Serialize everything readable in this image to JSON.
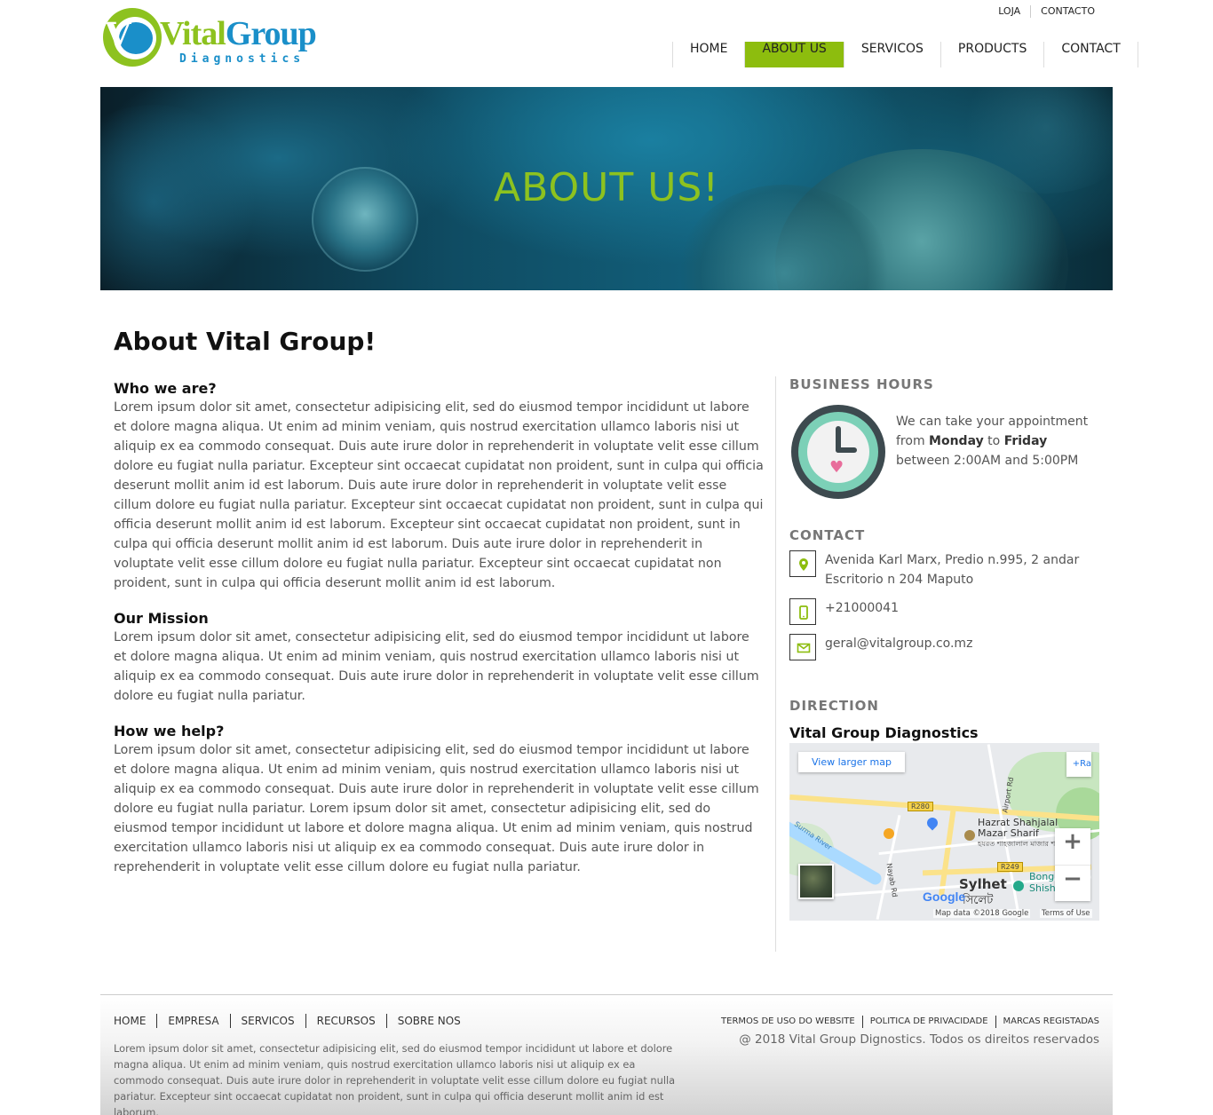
{
  "header": {
    "logo": {
      "brand_primary": "Vital",
      "brand_secondary": "Group",
      "tagline": "Diagnostics"
    },
    "top_links": [
      "LOJA",
      "CONTACTO"
    ],
    "nav": [
      {
        "label": "HOME",
        "active": false
      },
      {
        "label": "ABOUT US",
        "active": true
      },
      {
        "label": "SERVICOS",
        "active": false
      },
      {
        "label": "PRODUCTS",
        "active": false
      },
      {
        "label": "CONTACT",
        "active": false
      }
    ]
  },
  "hero": {
    "title": "ABOUT US!"
  },
  "main": {
    "page_title": "About Vital Group!",
    "sections": [
      {
        "heading": "Who we are?",
        "body": "Lorem ipsum dolor sit amet, consectetur adipisicing elit, sed do eiusmod tempor incididunt ut labore et dolore magna aliqua. Ut enim ad minim veniam, quis nostrud exercitation ullamco laboris nisi ut aliquip ex ea commodo consequat. Duis aute irure dolor in reprehenderit in voluptate velit esse cillum dolore eu fugiat nulla pariatur. Excepteur sint occaecat cupidatat non proident, sunt in culpa qui officia deserunt mollit anim id est laborum. Duis aute irure dolor in reprehenderit in voluptate velit esse cillum dolore eu fugiat nulla pariatur. Excepteur sint occaecat cupidatat non proident, sunt in culpa qui officia deserunt mollit anim id est laborum. Excepteur sint occaecat cupidatat non proident, sunt in culpa qui officia deserunt mollit anim id est laborum. Duis aute irure dolor in reprehenderit in voluptate velit esse cillum dolore eu fugiat nulla pariatur. Excepteur sint occaecat cupidatat non proident, sunt in culpa qui officia deserunt mollit anim id est laborum."
      },
      {
        "heading": "Our Mission",
        "body": "Lorem ipsum dolor sit amet, consectetur adipisicing elit, sed do eiusmod tempor incididunt ut labore et dolore magna aliqua. Ut enim ad minim veniam, quis nostrud exercitation ullamco laboris nisi ut aliquip ex ea commodo consequat. Duis aute irure dolor in reprehenderit in voluptate velit esse cillum dolore eu fugiat nulla pariatur."
      },
      {
        "heading": "How we help?",
        "body": "Lorem ipsum dolor sit amet, consectetur adipisicing elit, sed do eiusmod tempor incididunt ut labore et dolore magna aliqua. Ut enim ad minim veniam, quis nostrud exercitation ullamco laboris nisi ut aliquip ex ea commodo consequat. Duis aute irure dolor in reprehenderit in voluptate velit esse cillum dolore eu fugiat nulla pariatur. Lorem ipsum dolor sit amet, consectetur adipisicing elit, sed do eiusmod tempor incididunt ut labore et dolore magna aliqua. Ut enim ad minim veniam, quis nostrud exercitation ullamco laboris nisi ut aliquip ex ea commodo consequat. Duis aute irure dolor in reprehenderit in voluptate velit esse cillum dolore eu fugiat nulla pariatur."
      }
    ]
  },
  "sidebar": {
    "hours": {
      "heading": "BUSINESS HOURS",
      "text_before": "We can take your appointment from ",
      "day_from": "Monday",
      "text_mid": " to ",
      "day_to": "Friday",
      "text_after": " between 2:00AM and 5:00PM",
      "icon": "clock-icon"
    },
    "contact": {
      "heading": "CONTACT",
      "address": "Avenida Karl Marx, Predio n.995, 2 andar Escritorio n 204 Maputo",
      "phone": "+21000041",
      "email": "geral@vitalgroup.co.mz"
    },
    "direction": {
      "heading": "DIRECTION",
      "map_title": "Vital Group Diagnostics",
      "view_larger": "View larger map",
      "ra_link": "+Ra",
      "labels": {
        "road_r280": "R280",
        "road_r249": "R249",
        "shahjalal": "Hazrat Shahjalal Mazar Sharif",
        "shahjalal_bn": "হযরত শাহজালাল মাজার শরীফ",
        "sylhet": "Sylhet",
        "sylhet_bn": "সিলেট",
        "surma": "Surma River",
        "airport_rd": "Airport Rd",
        "nayab_rd": "Nayab Rd",
        "bongo": "Bong",
        "shish": "Shish",
        "google": "Google",
        "map_data": "Map data ©2018 Google",
        "terms": "Terms of Use"
      },
      "zoom_in": "+",
      "zoom_out": "−"
    }
  },
  "footer": {
    "nav": [
      "HOME",
      "EMPRESA",
      "SERVICOS",
      "RECURSOS",
      "SOBRE NOS"
    ],
    "text": "Lorem ipsum dolor sit amet, consectetur adipisicing elit, sed do eiusmod tempor incididunt ut labore et dolore magna aliqua. Ut enim ad minim veniam, quis nostrud exercitation ullamco laboris nisi ut aliquip ex ea commodo consequat. Duis aute irure dolor in reprehenderit in voluptate velit esse cillum dolore eu fugiat nulla pariatur. Excepteur sint occaecat cupidatat non proident, sunt in culpa qui officia deserunt mollit anim id est laborum.",
    "legal": [
      "TERMOS DE USO DO WEBSITE",
      "POLITICA DE PRIVACIDADE",
      "MARCAS REGISTADAS"
    ],
    "copyright": "@ 2018 Vital Group Dignostics. Todos os direitos reservados"
  },
  "colors": {
    "accent": "#8dbd0e",
    "brand_blue": "#1a8fc9",
    "brand_green": "#8dc21f"
  }
}
